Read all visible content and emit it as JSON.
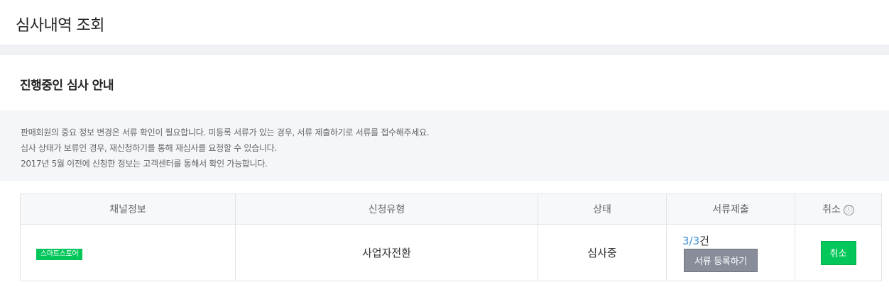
{
  "header": {
    "title": "심사내역 조회"
  },
  "section": {
    "title": "진행중인 심사 안내"
  },
  "notice": {
    "lines": [
      "판매회원의 중요 정보 변경은 서류 확인이 필요합니다. 미등록 서류가 있는 경우, 서류 제출하기로 서류를 접수해주세요.",
      "심사 상태가 보류인 경우, 재신청하기를 통해 재심사를 요청할 수 있습니다.",
      "2017년 5월 이전에 신청한 정보는 고객센터를 통해서 확인 가능합니다."
    ]
  },
  "table": {
    "columns": {
      "channel": "채널정보",
      "type": "신청유형",
      "status": "상태",
      "docs": "서류제출",
      "cancel": "취소"
    },
    "info_icon": "ⓘ",
    "rows": [
      {
        "channel_badge": "스마트스토어",
        "type": "사업자전환",
        "status": "심사중",
        "doc_count": "3/3",
        "doc_unit": "건",
        "doc_button": "서류 등록하기",
        "cancel_button": "취소"
      }
    ]
  },
  "colors": {
    "accent_green": "#03c75a",
    "link_blue": "#3b8fd6",
    "button_gray": "#888d99"
  }
}
